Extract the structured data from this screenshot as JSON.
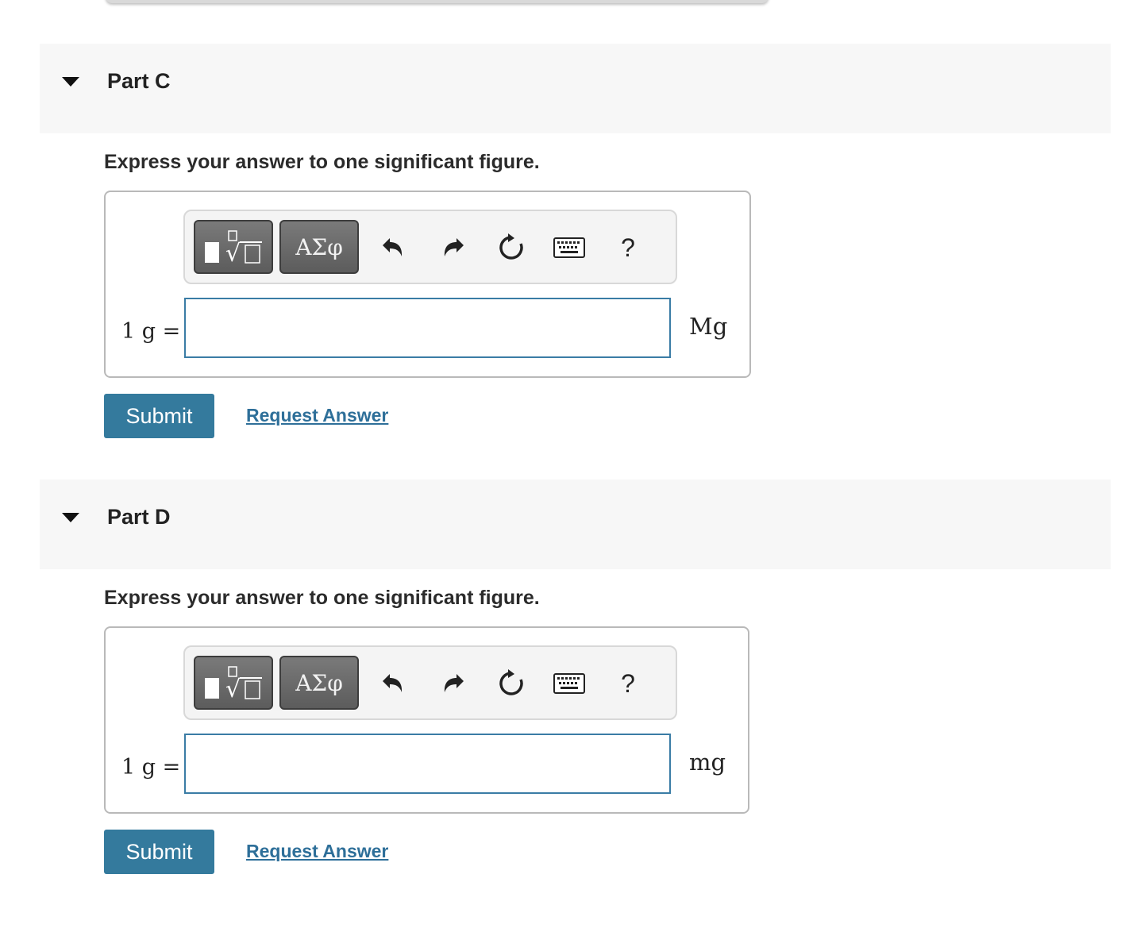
{
  "parts": [
    {
      "title": "Part C",
      "instruction": "Express your answer to one significant figure.",
      "toolbar": {
        "greek_label": "ΑΣφ",
        "help_label": "?"
      },
      "equation_label": "1 g =",
      "input_value": "",
      "unit": "Mg",
      "submit_label": "Submit",
      "request_label": "Request Answer"
    },
    {
      "title": "Part D",
      "instruction": "Express your answer to one significant figure.",
      "toolbar": {
        "greek_label": "ΑΣφ",
        "help_label": "?"
      },
      "equation_label": "1 g =",
      "input_value": "",
      "unit": "mg",
      "submit_label": "Submit",
      "request_label": "Request Answer"
    }
  ],
  "colors": {
    "accent": "#347a9d",
    "link": "#2e6f99",
    "header_bg": "#f7f7f7",
    "input_border": "#3a7ca5"
  },
  "icons": [
    "caret-down-icon",
    "templates-icon",
    "undo-icon",
    "redo-icon",
    "reset-icon",
    "keyboard-icon",
    "help-icon"
  ]
}
